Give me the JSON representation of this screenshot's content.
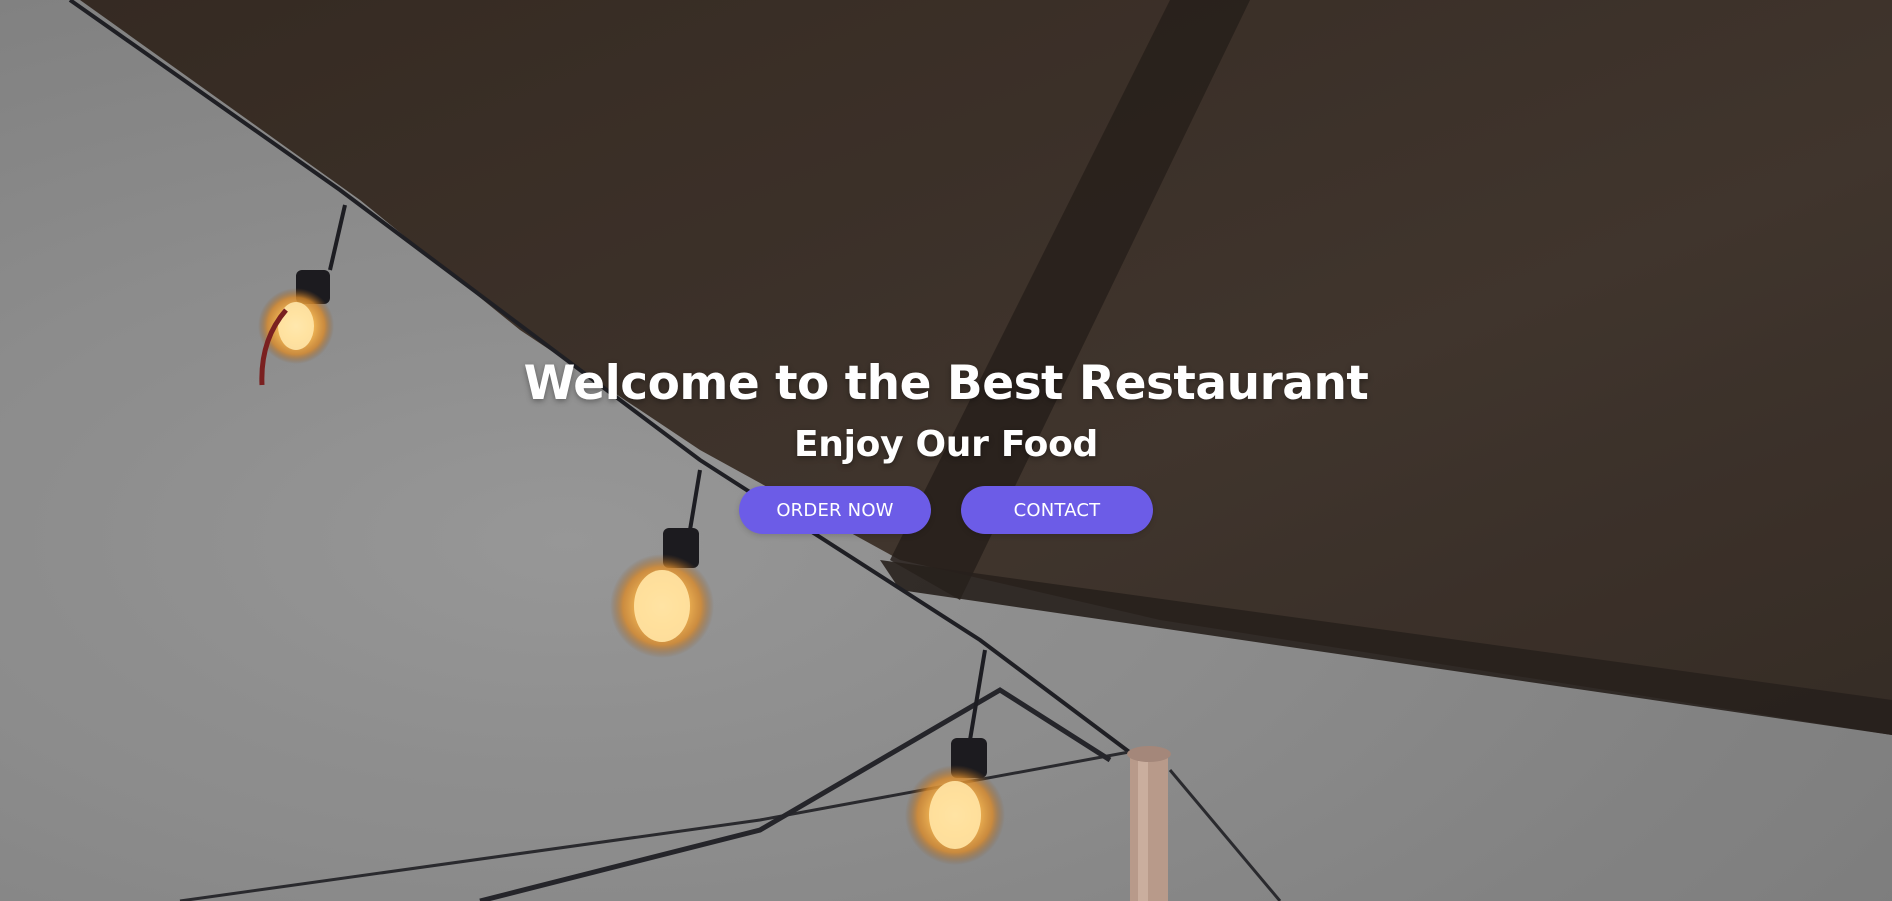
{
  "hero": {
    "title": "Welcome to the Best Restaurant",
    "subtitle": "Enjoy Our Food",
    "buttons": {
      "order_label": "ORDER NOW",
      "contact_label": "CONTACT"
    }
  },
  "colors": {
    "accent": "#6c5ce7",
    "text": "#ffffff",
    "sky": "#969696",
    "canopy": "#3d332c"
  },
  "background": {
    "scene": "hero-photo",
    "icons": [
      "light-bulb-icon"
    ]
  }
}
